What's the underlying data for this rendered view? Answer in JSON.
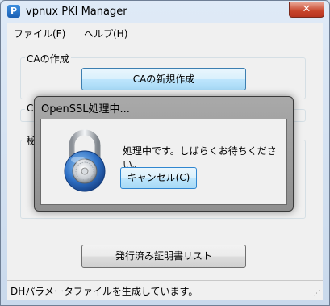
{
  "window": {
    "title": "vpnux PKI Manager",
    "close_glyph": "✕",
    "app_icon_glyph": "P"
  },
  "menu": {
    "file": "ファイル(F)",
    "help": "ヘルプ(H)"
  },
  "ca_group": {
    "label": "CAの作成",
    "new_ca_button": "CAの新規作成"
  },
  "partial_labels": {
    "group2_label_left": "C",
    "group3_label_left": "秘"
  },
  "issued_list_button": "発行済み証明書リスト",
  "status": {
    "text": "DHパラメータファイルを生成しています。"
  },
  "dialog": {
    "title": "OpenSSL処理中...",
    "message": "処理中です。しばらくお待ちください。",
    "cancel_button": "キャンセル(C)",
    "icon": "padlock-icon"
  }
}
